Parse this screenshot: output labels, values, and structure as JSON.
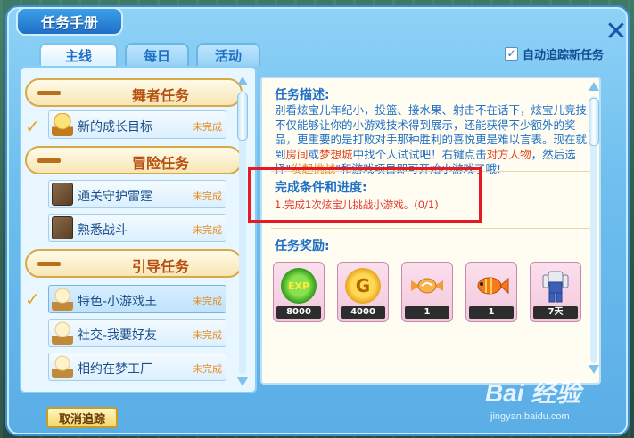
{
  "window": {
    "title": "任务手册",
    "close_symbol": "✕"
  },
  "tabs": [
    {
      "label": "主线",
      "active": true
    },
    {
      "label": "每日",
      "active": false
    },
    {
      "label": "活动",
      "active": false
    }
  ],
  "auto_track": {
    "label": "自动追踪新任务",
    "checked": true,
    "check_symbol": "✓"
  },
  "task_list": {
    "categories": [
      {
        "name": "舞者任务",
        "tasks": [
          {
            "name": "新的成长目标",
            "status": "未完成",
            "icon": "medal-icon",
            "checked": true
          }
        ]
      },
      {
        "name": "冒险任务",
        "tasks": [
          {
            "name": "通关守护雷霆",
            "status": "未完成",
            "icon": "adventure-icon",
            "checked": false
          },
          {
            "name": "熟悉战斗",
            "status": "未完成",
            "icon": "adventure-icon",
            "checked": false
          }
        ]
      },
      {
        "name": "引导任务",
        "tasks": [
          {
            "name": "特色-小游戏王",
            "status": "未完成",
            "icon": "guide-icon",
            "checked": true,
            "selected": true
          },
          {
            "name": "社交-我要好友",
            "status": "未完成",
            "icon": "guide-icon",
            "checked": false
          },
          {
            "name": "相约在梦工厂",
            "status": "未完成",
            "icon": "guide-icon",
            "checked": false
          }
        ]
      }
    ],
    "check_symbol": "✓"
  },
  "detail": {
    "description_heading": "任务描述:",
    "description_parts": {
      "p1": "别看炫宝儿年纪小，投篮、接水果、射击不在话下，炫宝儿竞技不仅能够让你的小游戏技术得到展示，还能获得不少额外的奖品，更重要的是打败对手那种胜利的喜悦更是难以言表。现在就到",
      "p2": "房间",
      "p3": "或",
      "p4": "梦想城",
      "p5": "中找个人试试吧！右键点击",
      "p6": "对方人物",
      "p7": "，然后选择\"",
      "p8": "发起挑战",
      "p9": "\"和游戏项目即可开始小游戏了哦!"
    },
    "progress_heading": "完成条件和进度:",
    "progress_item": "1.完成1次炫宝儿挑战小游戏。(0/1)",
    "reward_heading": "任务奖励:",
    "rewards": [
      {
        "icon": "exp-icon",
        "badge": "EXP",
        "quantity": "8000"
      },
      {
        "icon": "gold-coin-icon",
        "badge": "G",
        "quantity": "4000"
      },
      {
        "icon": "candy-icon",
        "badge": "",
        "quantity": "1"
      },
      {
        "icon": "fish-icon",
        "badge": "",
        "quantity": "1"
      },
      {
        "icon": "outfit-icon",
        "badge": "",
        "quantity": "7天"
      }
    ]
  },
  "buttons": {
    "cancel_tracking": "取消追踪"
  },
  "watermark": {
    "logo": "Bai 经验",
    "site": "jingyan.baidu.com"
  },
  "colors": {
    "accent_blue": "#1f6fc6",
    "highlight_red": "#e51a25",
    "status_orange": "#e58a1a"
  }
}
